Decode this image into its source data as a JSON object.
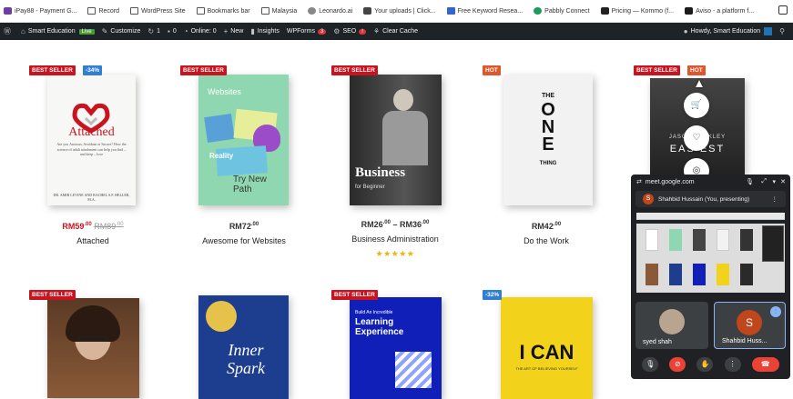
{
  "bookmarks": [
    {
      "label": "iPay88 - Payment G..."
    },
    {
      "label": "Record"
    },
    {
      "label": "WordPress Site"
    },
    {
      "label": "Bookmarks bar"
    },
    {
      "label": "Malaysia"
    },
    {
      "label": "Leonardo.ai"
    },
    {
      "label": "Your uploads | Click..."
    },
    {
      "label": "Free Keyword Resea..."
    },
    {
      "label": "Pabbly Connect"
    },
    {
      "label": "Pricing — Kommo (f..."
    },
    {
      "label": "Aviso - a platform f..."
    }
  ],
  "adminbar": {
    "site": "Smart Education",
    "live": "Live",
    "customize": "Customize",
    "updates": "1",
    "comments": "0",
    "online": "Online: 0",
    "new": "New",
    "insights": "Insights",
    "wpforms": "WPForms",
    "wpforms_count": "3",
    "seo": "SEO",
    "seo_count": "!",
    "cache": "Clear Cache",
    "howdy": "Howdy, Smart Education"
  },
  "products": [
    {
      "tag1": "BEST SELLER",
      "tag2": "-34%",
      "price": "RM59",
      "price_dec": ".00",
      "old": "RM89",
      "old_dec": ".00",
      "title": "Attached"
    },
    {
      "tag1": "BEST SELLER",
      "price": "RM72",
      "price_dec": ".00",
      "title": "Awesome for Websites"
    },
    {
      "tag1": "BEST SELLER",
      "price": "RM26",
      "price_dec": ".00",
      "price_sep": " – ",
      "price2": "RM36",
      "price2_dec": ".00",
      "title": "Business Administration",
      "stars": "★★★★★"
    },
    {
      "tag1": "HOT",
      "price": "RM42",
      "price_dec": ".00",
      "title": "Do the Work"
    },
    {
      "tag1": "BEST SELLER",
      "tag2": "HOT"
    },
    {
      "tag1": "BEST SELLER"
    },
    {},
    {
      "tag1": "BEST SELLER"
    },
    {
      "tag1": "-32%"
    }
  ],
  "covers": {
    "attached_title": "Attached",
    "attached_sub": "Are you Anxious, Avoidant or Secure? How the science of adult attachment can help you find – and keep – love",
    "attached_authors": "DR. AMIR LEVINE AND RACHEL S.F. HELLER, M.A.",
    "websites_title": "Websites",
    "websites_word": "Reality",
    "websites_word2": "Try New Path",
    "business_title": "Business",
    "business_sub": "for Beginner",
    "onething": [
      "THE",
      "ONE",
      "THING"
    ],
    "jasper_text": "JASON BERKLEY",
    "jasper_title": "EAS EST",
    "inner_spark": "Inner Spark",
    "learning_small": "Build An Incredible",
    "learning_title": "Learning Experience",
    "ican_title": "I CAN",
    "ican_sub": "THE ART OF BELIEVING YOURSELF"
  },
  "meet": {
    "url": "meet.google.com",
    "presenter_initial": "S",
    "presenter": "Shahbid Hussain (You, presenting)",
    "tile1_name": "syed shah",
    "tile2_name": "Shahbid Huss...",
    "tile2_initial": "S"
  },
  "colors": {
    "best_seller": "#c9141f",
    "discount": "#2f7fd4",
    "hot": "#e0562c",
    "adminbar": "#1d2327"
  }
}
